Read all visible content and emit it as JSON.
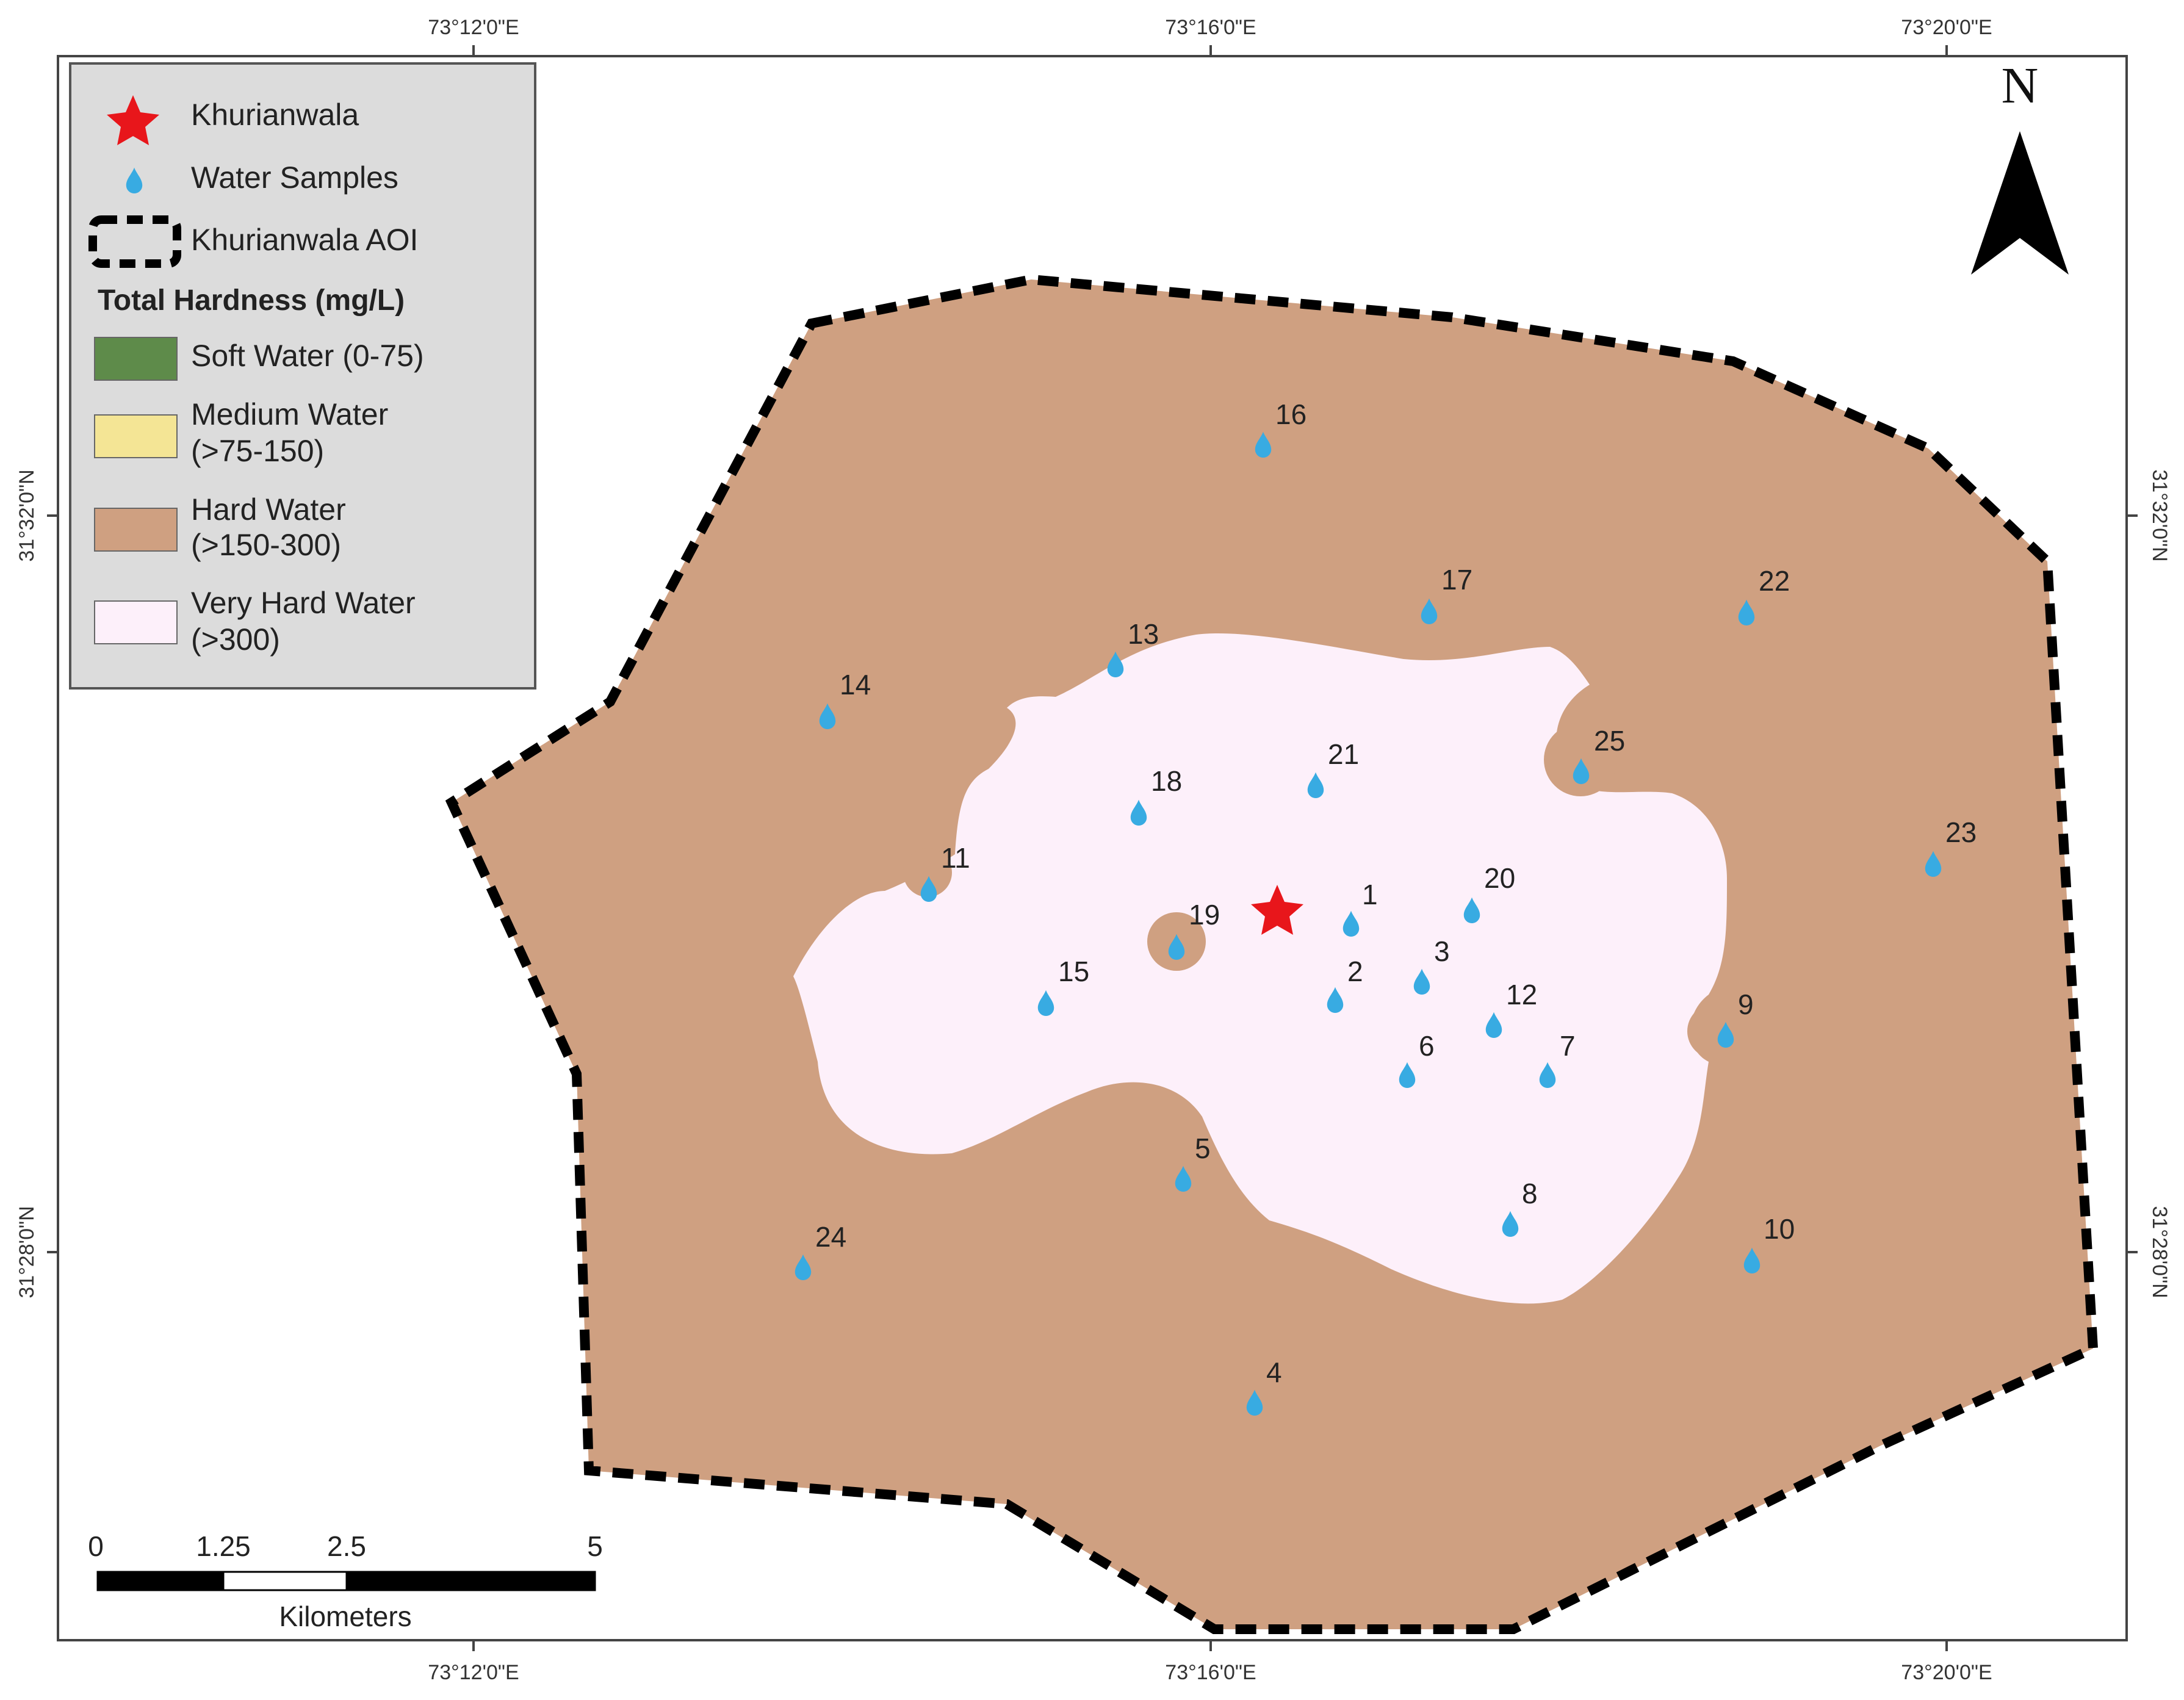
{
  "map": {
    "coords": {
      "top": [
        "73°12'0\"E",
        "73°16'0\"E",
        "73°20'0\"E"
      ],
      "bottom": [
        "73°12'0\"E",
        "73°16'0\"E",
        "73°20'0\"E"
      ],
      "left": [
        "31°32'0\"N",
        "31°28'0\"N"
      ],
      "right": [
        "31°32'0\"N",
        "31°28'0\"N"
      ]
    },
    "north_label": "N",
    "colors": {
      "hard_water": "#cfa081",
      "very_hard_water": "#fdf0fa",
      "soft_water": "#5e8b4a",
      "medium_water": "#f4e595",
      "marker": "#38abe2",
      "star": "#e8161b",
      "legend_bg": "#dcdcdc"
    },
    "samples": [
      {
        "id": "1",
        "label": "1"
      },
      {
        "id": "2",
        "label": "2"
      },
      {
        "id": "3",
        "label": "3"
      },
      {
        "id": "4",
        "label": "4"
      },
      {
        "id": "5",
        "label": "5"
      },
      {
        "id": "6",
        "label": "6"
      },
      {
        "id": "7",
        "label": "7"
      },
      {
        "id": "8",
        "label": "8"
      },
      {
        "id": "9",
        "label": "9"
      },
      {
        "id": "10",
        "label": "10"
      },
      {
        "id": "11",
        "label": "11"
      },
      {
        "id": "12",
        "label": "12"
      },
      {
        "id": "13",
        "label": "13"
      },
      {
        "id": "14",
        "label": "14"
      },
      {
        "id": "15",
        "label": "15"
      },
      {
        "id": "16",
        "label": "16"
      },
      {
        "id": "17",
        "label": "17"
      },
      {
        "id": "18",
        "label": "18"
      },
      {
        "id": "19",
        "label": "19"
      },
      {
        "id": "20",
        "label": "20"
      },
      {
        "id": "21",
        "label": "21"
      },
      {
        "id": "22",
        "label": "22"
      },
      {
        "id": "23",
        "label": "23"
      },
      {
        "id": "24",
        "label": "24"
      },
      {
        "id": "25",
        "label": "25"
      }
    ]
  },
  "legend": {
    "items": [
      {
        "label": "Khurianwala",
        "icon": "star-icon"
      },
      {
        "label": "Water Samples",
        "icon": "water-drop-icon"
      },
      {
        "label": "Khurianwala AOI",
        "icon": "dashed-boundary-icon"
      }
    ],
    "title": "Total Hardness (mg/L)",
    "classes": [
      {
        "line1": "Soft Water (0-75)",
        "line2": ""
      },
      {
        "line1": "Medium Water",
        "line2": "(>75-150)"
      },
      {
        "line1": "Hard Water",
        "line2": "(>150-300)"
      },
      {
        "line1": "Very Hard Water",
        "line2": "(>300)"
      }
    ]
  },
  "scale_bar": {
    "ticks": [
      "0",
      "1.25",
      "2.5",
      "5"
    ],
    "unit": "Kilometers"
  }
}
